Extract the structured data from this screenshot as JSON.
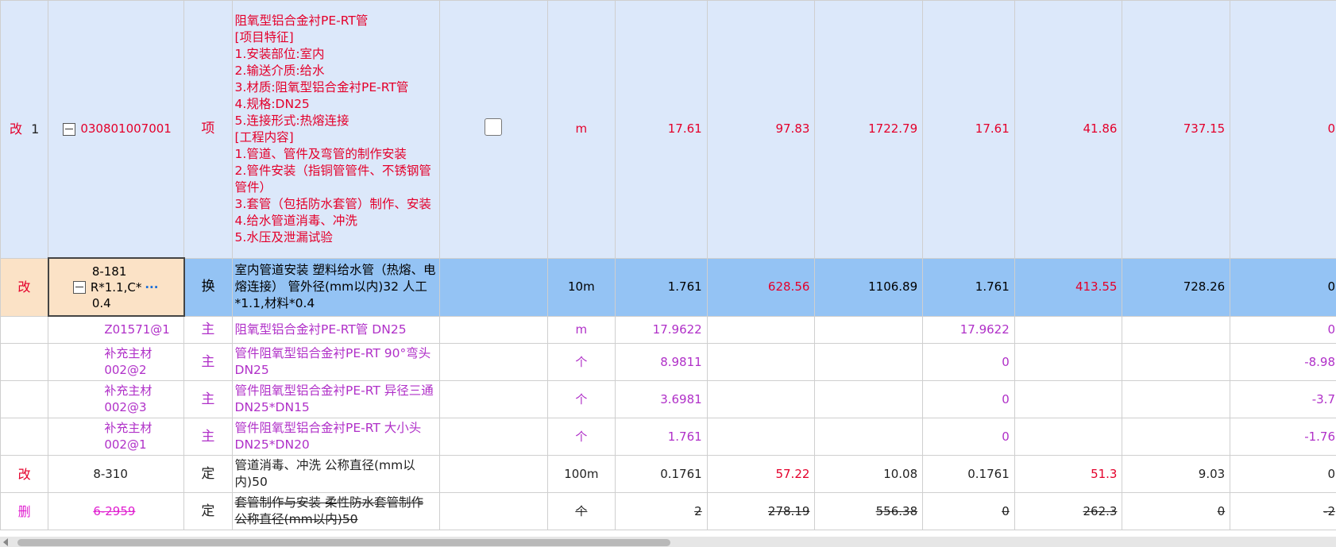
{
  "rows": [
    {
      "mark": "改",
      "num": "1",
      "code": "030801007001",
      "type": "项",
      "desc": "阻氧型铝合金衬PE-RT管\n[项目特征]\n1.安装部位:室内\n2.输送介质:给水\n3.材质:阻氧型铝合金衬PE-RT管\n4.规格:DN25\n5.连接形式:热熔连接\n[工程内容]\n1.管道、管件及弯管的制作安装\n2.管件安装（指铜管管件、不锈钢管管件）\n3.套管（包括防水套管）制作、安装\n4.给水管道消毒、冲洗\n5.水压及泄漏试验",
      "unit": "m",
      "v1": "17.61",
      "v2": "97.83",
      "v3": "1722.79",
      "v4": "17.61",
      "v5": "41.86",
      "v6": "737.15",
      "v7": "0"
    },
    {
      "mark": "改",
      "code_line1": "8-181",
      "code_line2": "R*1.1,C*",
      "code_line3": "0.4",
      "ellipsis": "···",
      "type": "换",
      "desc": "室内管道安装 塑料给水管（热熔、电熔连接） 管外径(mm以内)32  人工*1.1,材料*0.4",
      "unit": "10m",
      "v1": "1.761",
      "v2": "628.56",
      "v3": "1106.89",
      "v4": "1.761",
      "v5": "413.55",
      "v6": "728.26",
      "v7": "0"
    },
    {
      "mark": "",
      "code": "Z01571@1",
      "type": "主",
      "desc": "阻氧型铝合金衬PE-RT管  DN25",
      "unit": "m",
      "v1": "17.9622",
      "v2": "",
      "v3": "",
      "v4": "17.9622",
      "v5": "",
      "v6": "",
      "v7": "0"
    },
    {
      "mark": "",
      "code": "补充主材\n002@2",
      "type": "主",
      "desc": "管件阻氧型铝合金衬PE-RT 90°弯头 DN25",
      "unit": "个",
      "v1": "8.9811",
      "v2": "",
      "v3": "",
      "v4": "0",
      "v5": "",
      "v6": "",
      "v7": "-8.98"
    },
    {
      "mark": "",
      "code": "补充主材\n002@3",
      "type": "主",
      "desc": "管件阻氧型铝合金衬PE-RT 异径三通 DN25*DN15",
      "unit": "个",
      "v1": "3.6981",
      "v2": "",
      "v3": "",
      "v4": "0",
      "v5": "",
      "v6": "",
      "v7": "-3.7"
    },
    {
      "mark": "",
      "code": "补充主材\n002@1",
      "type": "主",
      "desc": "管件阻氧型铝合金衬PE-RT 大小头 DN25*DN20",
      "unit": "个",
      "v1": "1.761",
      "v2": "",
      "v3": "",
      "v4": "0",
      "v5": "",
      "v6": "",
      "v7": "-1.76"
    },
    {
      "mark": "改",
      "code": "8-310",
      "type": "定",
      "desc": "管道消毒、冲洗 公称直径(mm以内)50",
      "unit": "100m",
      "v1": "0.1761",
      "v2": "57.22",
      "v3": "10.08",
      "v4": "0.1761",
      "v5": "51.3",
      "v6": "9.03",
      "v7": "0"
    },
    {
      "mark": "删",
      "code": "6-2959",
      "type": "定",
      "desc": "套管制作与安装 柔性防水套管制作 公称直径(mm以内)50",
      "unit": "个",
      "v1": "2",
      "v2": "278.19",
      "v3": "556.38",
      "v4": "0",
      "v5": "262.3",
      "v6": "0",
      "v7": "-2"
    }
  ],
  "colors": {
    "item_row_bg": "#dce8fa",
    "selected_row_bg": "#94c3f4",
    "mark_cell_bg": "#fbe2c6",
    "red_text": "#e4002b",
    "purple_text": "#b030c8"
  },
  "icons": {
    "tree_toggle": "minus-square-icon",
    "checkbox": "checkbox-icon",
    "scroll": "scroll-left-arrow-icon"
  }
}
